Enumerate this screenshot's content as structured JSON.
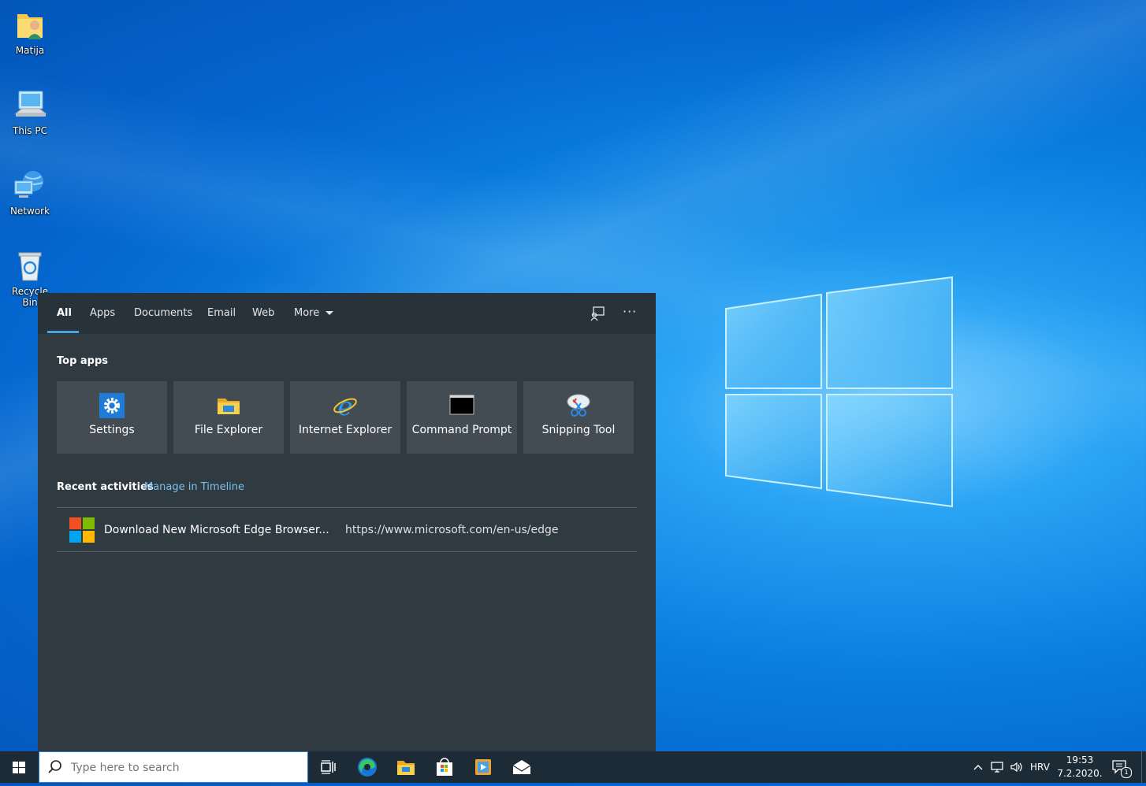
{
  "desktop": {
    "icons": [
      {
        "label": "Matija",
        "icon": "user-folder-icon"
      },
      {
        "label": "This PC",
        "icon": "computer-icon"
      },
      {
        "label": "Network",
        "icon": "network-icon"
      },
      {
        "label": "Recycle Bin",
        "icon": "recycle-bin-icon"
      }
    ]
  },
  "search_panel": {
    "tabs": [
      "All",
      "Apps",
      "Documents",
      "Email",
      "Web",
      "More"
    ],
    "active_tab": "All",
    "top_apps_heading": "Top apps",
    "top_apps": [
      {
        "label": "Settings",
        "icon": "gear-icon"
      },
      {
        "label": "File Explorer",
        "icon": "folder-icon"
      },
      {
        "label": "Internet Explorer",
        "icon": "ie-icon"
      },
      {
        "label": "Command Prompt",
        "icon": "cmd-icon"
      },
      {
        "label": "Snipping Tool",
        "icon": "scissors-icon"
      }
    ],
    "recent_heading": "Recent activities",
    "manage_link": "Manage in Timeline",
    "recent_items": [
      {
        "title": "Download New Microsoft Edge Browser...",
        "url": "https://www.microsoft.com/en-us/edge",
        "icon": "microsoft-logo-icon"
      }
    ]
  },
  "taskbar": {
    "search_placeholder": "Type here to search",
    "pinned": [
      "task-view-icon",
      "edge-icon",
      "file-explorer-icon",
      "store-icon",
      "media-player-icon",
      "mail-icon"
    ],
    "language": "HRV",
    "time": "19:53",
    "date": "7.2.2020.",
    "notification_count": "1"
  },
  "colors": {
    "panel_bg": "#2f3a41",
    "tile_bg": "#434c53",
    "accent": "#4aa3df",
    "link": "#7cc0ef",
    "taskbar_bg": "#1d2b36"
  }
}
